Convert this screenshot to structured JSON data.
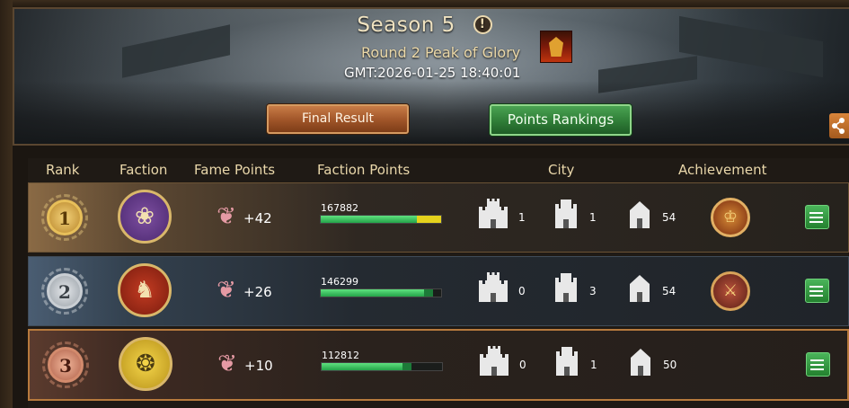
{
  "header": {
    "season_title": "Season 5",
    "round_title": "Round 2 Peak of Glory",
    "gmt": "GMT:2026-01-25 18:40:01",
    "tabs": [
      {
        "label": "Final Result",
        "active": false
      },
      {
        "label": "Points Rankings",
        "active": true
      }
    ]
  },
  "columns": {
    "rank": "Rank",
    "faction": "Faction",
    "fame_points": "Fame Points",
    "faction_points": "Faction Points",
    "city": "City",
    "achievement": "Achievement"
  },
  "rows": [
    {
      "rank": "1",
      "faction_icon": "dragon-sigil-icon",
      "fame_points": "+42",
      "faction_points": "167882",
      "points_bar_fraction": 0.8,
      "points_bar_extra_fraction": 0.2,
      "city_large": "1",
      "city_medium": "1",
      "city_small": "54",
      "achievement_icon": "crown-badge-icon"
    },
    {
      "rank": "2",
      "faction_icon": "lion-sigil-icon",
      "fame_points": "+26",
      "faction_points": "146299",
      "points_bar_fraction": 0.86,
      "points_bar_extra_fraction": 0.07,
      "city_large": "0",
      "city_medium": "3",
      "city_small": "54",
      "achievement_icon": "sword-badge-icon"
    },
    {
      "rank": "3",
      "faction_icon": "wolf-sigil-icon",
      "fame_points": "+10",
      "faction_points": "112812",
      "points_bar_fraction": 0.67,
      "points_bar_extra_fraction": 0.08,
      "city_large": "0",
      "city_medium": "1",
      "city_small": "50",
      "achievement_icon": ""
    }
  ],
  "colors": {
    "active_tab": "#2f7d37",
    "inactive_tab": "#9f5428",
    "bar_fill": "#24a349",
    "bar_extra_first": "#e5d21c",
    "row1_border": "#6b5335",
    "row3_border": "#b77a3d"
  }
}
